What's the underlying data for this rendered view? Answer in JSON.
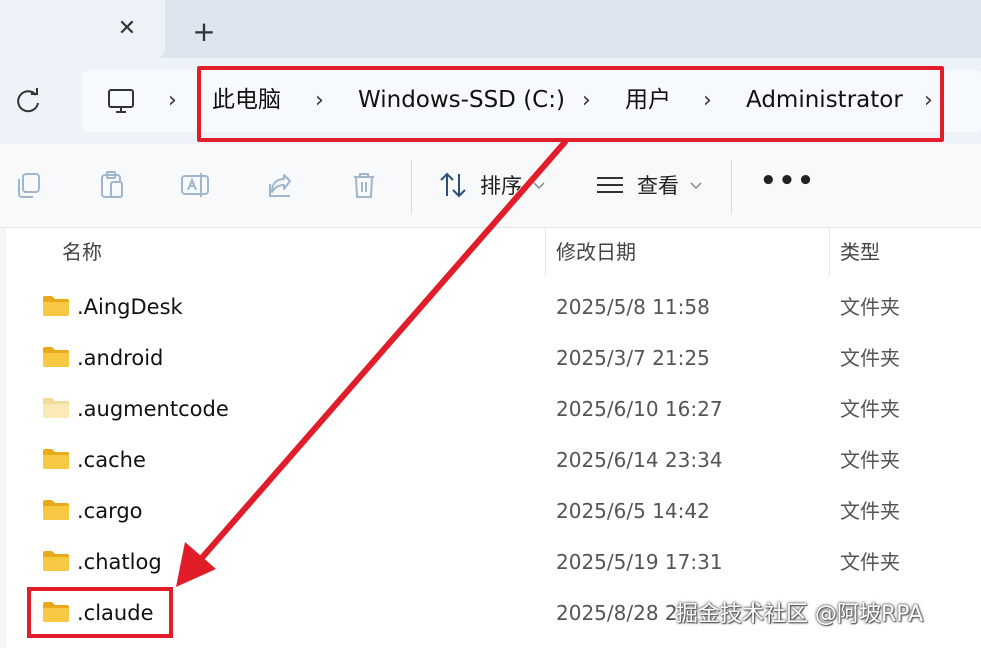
{
  "window": {
    "tab_close_glyph": "✕",
    "tab_add_glyph": "+"
  },
  "address_bar": {
    "separator": "›",
    "crumbs": [
      "此电脑",
      "Windows-SSD (C:)",
      "用户",
      "Administrator"
    ]
  },
  "toolbar": {
    "sort_label": "排序",
    "view_label": "查看",
    "more_label": "•••",
    "icons": [
      "copy-icon",
      "paste-icon",
      "rename-icon",
      "share-icon",
      "delete-icon",
      "sort-icon",
      "view-icon",
      "more-icon"
    ]
  },
  "file_list": {
    "columns": [
      "名称",
      "修改日期",
      "类型"
    ],
    "rows": [
      {
        "name": ".AingDesk",
        "date": "2025/5/8 11:58",
        "type": "文件夹"
      },
      {
        "name": ".android",
        "date": "2025/3/7 21:25",
        "type": "文件夹"
      },
      {
        "name": ".augmentcode",
        "date": "2025/6/10 16:27",
        "type": "文件夹"
      },
      {
        "name": ".cache",
        "date": "2025/6/14 23:34",
        "type": "文件夹"
      },
      {
        "name": ".cargo",
        "date": "2025/6/5 14:42",
        "type": "文件夹"
      },
      {
        "name": ".chatlog",
        "date": "2025/5/19 17:31",
        "type": "文件夹"
      },
      {
        "name": ".claude",
        "date": "2025/8/28 2",
        "type": ""
      }
    ]
  },
  "watermark": "掘金技术社区 @阿坡RPA",
  "colors": {
    "annotation_red": "#e11d2a",
    "folder_yellow": "#f5c33b"
  }
}
